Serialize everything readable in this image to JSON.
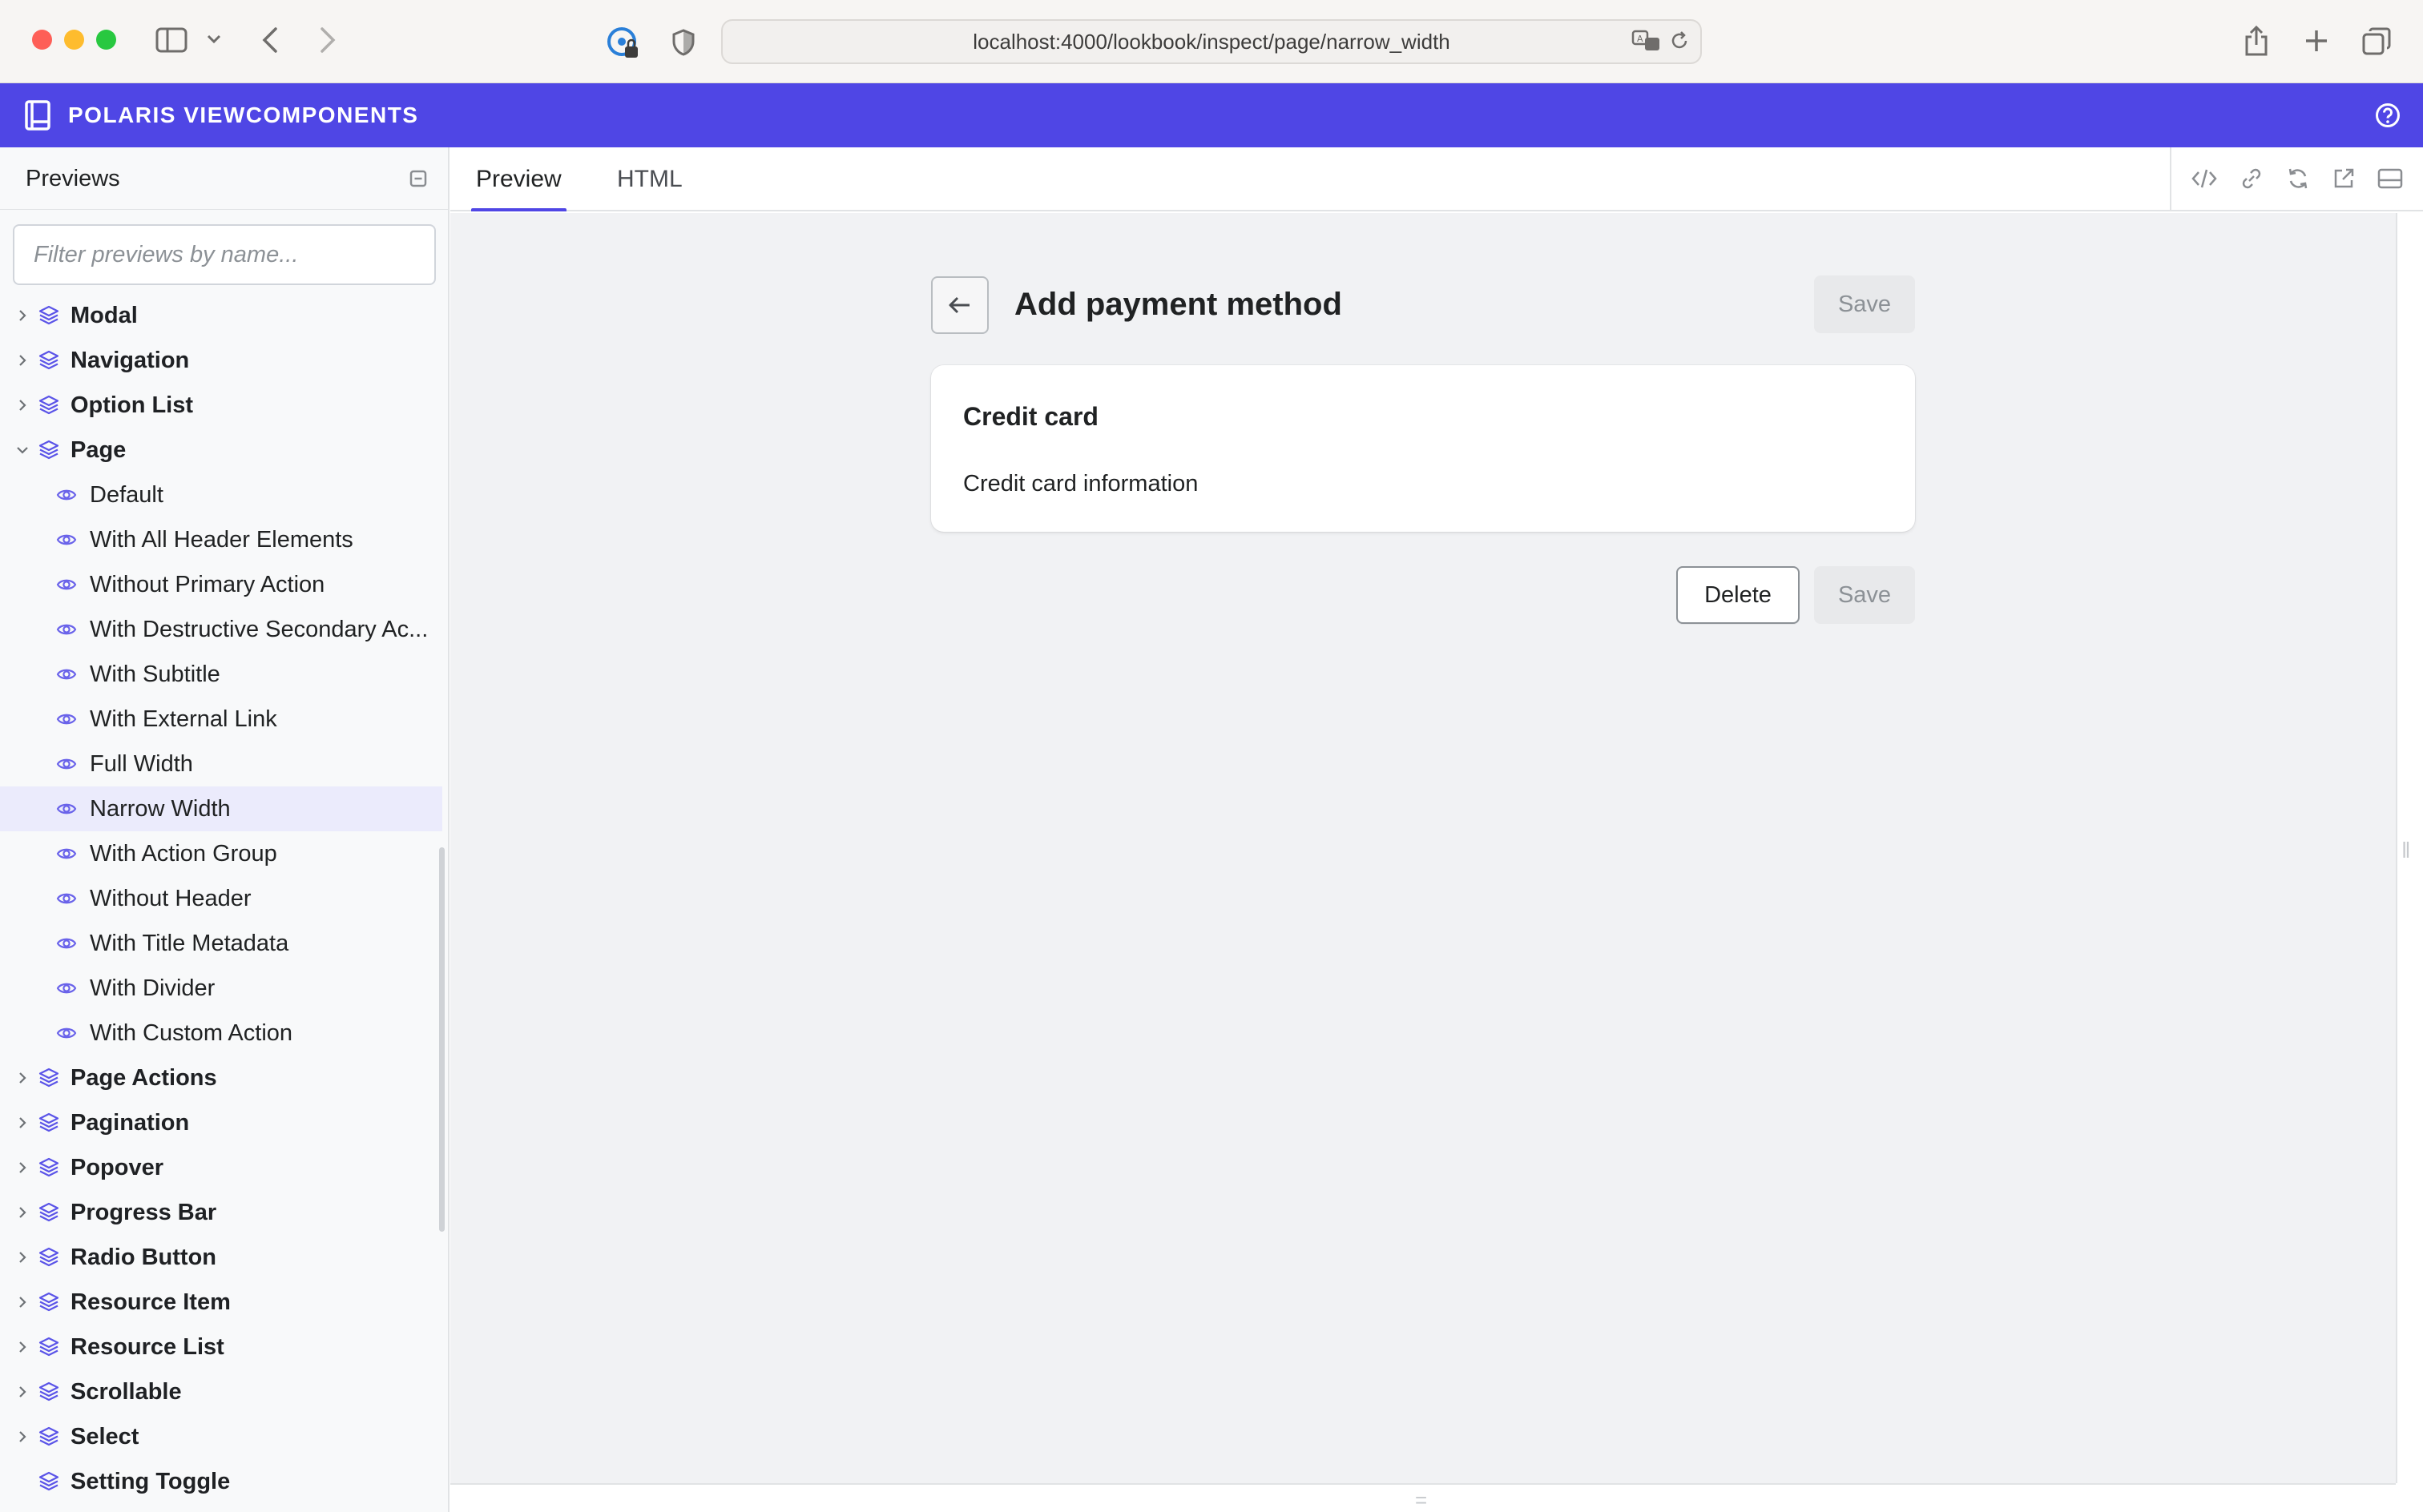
{
  "browser": {
    "url": "localhost:4000/lookbook/inspect/page/narrow_width"
  },
  "app": {
    "title": "POLARIS VIEWCOMPONENTS",
    "accent": "#4f46e5"
  },
  "sidebar": {
    "title": "Previews",
    "filter_placeholder": "Filter previews by name...",
    "groups_before": [
      {
        "label": "Modal"
      },
      {
        "label": "Navigation"
      },
      {
        "label": "Option List"
      }
    ],
    "expanded_group": {
      "label": "Page",
      "items": [
        {
          "label": "Default"
        },
        {
          "label": "With All Header Elements"
        },
        {
          "label": "Without Primary Action"
        },
        {
          "label": "With Destructive Secondary Ac..."
        },
        {
          "label": "With Subtitle"
        },
        {
          "label": "With External Link"
        },
        {
          "label": "Full Width"
        },
        {
          "label": "Narrow Width",
          "active": true
        },
        {
          "label": "With Action Group"
        },
        {
          "label": "Without Header"
        },
        {
          "label": "With Title Metadata"
        },
        {
          "label": "With Divider"
        },
        {
          "label": "With Custom Action"
        }
      ]
    },
    "groups_after": [
      {
        "label": "Page Actions"
      },
      {
        "label": "Pagination"
      },
      {
        "label": "Popover"
      },
      {
        "label": "Progress Bar"
      },
      {
        "label": "Radio Button"
      },
      {
        "label": "Resource Item"
      },
      {
        "label": "Resource List"
      },
      {
        "label": "Scrollable"
      },
      {
        "label": "Select"
      },
      {
        "label": "Setting Toggle"
      }
    ]
  },
  "tabs": {
    "preview": "Preview",
    "html": "HTML"
  },
  "preview": {
    "page_title": "Add payment method",
    "header_save": "Save",
    "card_title": "Credit card",
    "card_body": "Credit card information",
    "delete_label": "Delete",
    "footer_save": "Save"
  },
  "icons": {
    "tools": [
      "code-icon",
      "link-icon",
      "refresh-icon",
      "external-link-icon",
      "panel-toggle-icon"
    ]
  }
}
